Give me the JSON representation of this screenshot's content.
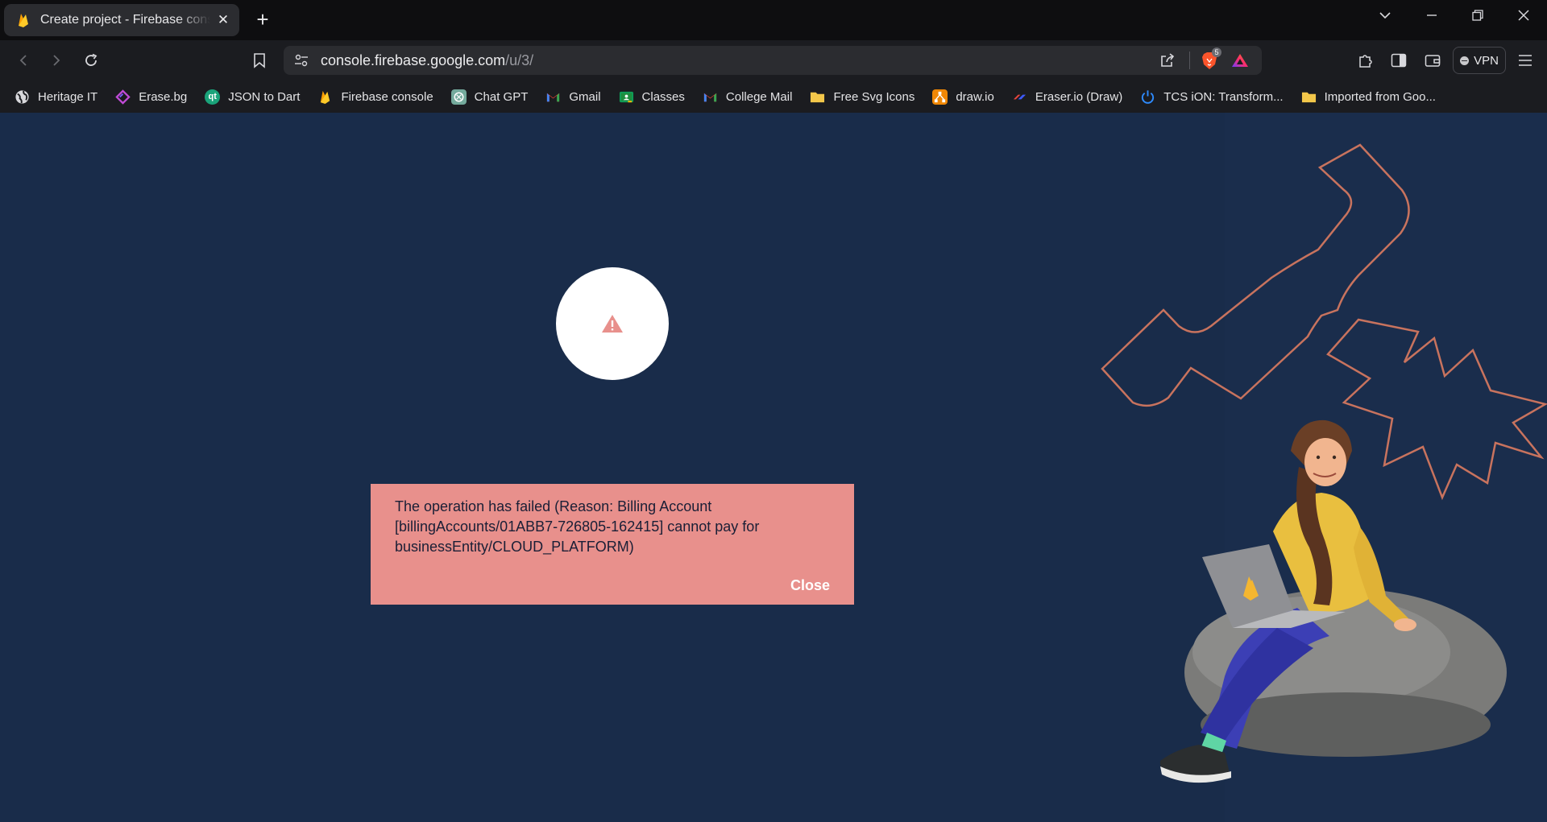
{
  "browser": {
    "tab": {
      "title": "Create project - Firebase console"
    },
    "address_bar": {
      "host": "console.firebase.google.com",
      "path": "/u/3/"
    },
    "shields_count": "5",
    "vpn_label": "VPN"
  },
  "bookmarks": [
    {
      "label": "Heritage IT",
      "icon": "globe-icon"
    },
    {
      "label": "Erase.bg",
      "icon": "erasebg-icon"
    },
    {
      "label": "JSON to Dart",
      "icon": "qt-icon"
    },
    {
      "label": "Firebase console",
      "icon": "firebase-icon"
    },
    {
      "label": "Chat GPT",
      "icon": "chatgpt-icon"
    },
    {
      "label": "Gmail",
      "icon": "gmail-icon"
    },
    {
      "label": "Classes",
      "icon": "classroom-icon"
    },
    {
      "label": "College Mail",
      "icon": "gmail-icon"
    },
    {
      "label": "Free Svg Icons",
      "icon": "folder-icon"
    },
    {
      "label": "draw.io",
      "icon": "drawio-icon"
    },
    {
      "label": "Eraser.io (Draw)",
      "icon": "eraser-icon"
    },
    {
      "label": "TCS iON: Transform...",
      "icon": "power-icon"
    },
    {
      "label": "Imported from Goo...",
      "icon": "folder-icon"
    }
  ],
  "error_dialog": {
    "message": "The operation has failed (Reason: Billing Account [billingAccounts/01ABB7-726805-162415] cannot pay for businessEntity/CLOUD_PLATFORM)",
    "close_label": "Close",
    "status_icon": "warning-icon"
  },
  "colors": {
    "page_background": "#192c4a",
    "error_background": "#e8908c",
    "warning_icon": "#e8908c",
    "illustration_outline": "#c8735e"
  }
}
